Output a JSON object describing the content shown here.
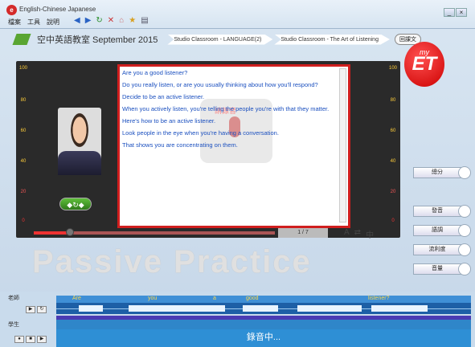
{
  "app": {
    "title": "English-Chinese Japanese",
    "logo": "myET",
    "menu": [
      "檔案",
      "工具",
      "說明"
    ],
    "toolbar_icons": [
      "back-icon",
      "forward-icon",
      "refresh-icon",
      "stop-icon",
      "home-icon",
      "star-icon",
      "print-icon"
    ]
  },
  "breadcrumb": {
    "main": "空中英語教室 September 2015",
    "crumb1": "Studio Classroom - LANGUAGE(2)",
    "crumb2": "Studio Classroom - The Art of Listening",
    "review_label": "回課文"
  },
  "logo": {
    "small": "my",
    "big": "ET"
  },
  "meter_ticks": [
    "100",
    "80",
    "60",
    "40",
    "20",
    "0"
  ],
  "transcript": {
    "lines": [
      "Are you a good listener?",
      "Do you really listen, or are you usually thinking about how you'll respond?",
      "Decide to be an active listener.",
      "When you actively listen, you're telling the people you're with that they matter.",
      "Here's how to be an active listener.",
      "Look people in the eye when you're having a conversation.",
      "That shows you are concentrating on them."
    ],
    "watermark_text": "請錄音"
  },
  "player": {
    "page": "1 / 7",
    "progress": 0.15
  },
  "caption": "Passive Practice",
  "side_buttons": [
    "總分",
    "發音",
    "語調",
    "流利度",
    "音量"
  ],
  "bottom": {
    "teacher_label": "老師",
    "student_label": "學生",
    "words": [
      "Are",
      "you",
      "a",
      "good",
      "listener?"
    ],
    "recording_label": "錄音中..."
  },
  "colors": {
    "accent": "#d01e1e",
    "link": "#1a4fbf",
    "wave": "#1d5fa6"
  }
}
